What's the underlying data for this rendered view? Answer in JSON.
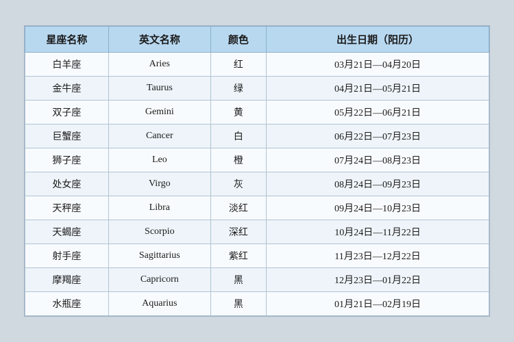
{
  "table": {
    "headers": {
      "zh_name": "星座名称",
      "en_name": "英文名称",
      "color": "颜色",
      "date": "出生日期（阳历）"
    },
    "rows": [
      {
        "zh": "白羊座",
        "en": "Aries",
        "color": "红",
        "date": "03月21日—04月20日"
      },
      {
        "zh": "金牛座",
        "en": "Taurus",
        "color": "绿",
        "date": "04月21日—05月21日"
      },
      {
        "zh": "双子座",
        "en": "Gemini",
        "color": "黄",
        "date": "05月22日—06月21日"
      },
      {
        "zh": "巨蟹座",
        "en": "Cancer",
        "color": "白",
        "date": "06月22日—07月23日"
      },
      {
        "zh": "狮子座",
        "en": "Leo",
        "color": "橙",
        "date": "07月24日—08月23日"
      },
      {
        "zh": "处女座",
        "en": "Virgo",
        "color": "灰",
        "date": "08月24日—09月23日"
      },
      {
        "zh": "天秤座",
        "en": "Libra",
        "color": "淡红",
        "date": "09月24日—10月23日"
      },
      {
        "zh": "天蝎座",
        "en": "Scorpio",
        "color": "深红",
        "date": "10月24日—11月22日"
      },
      {
        "zh": "射手座",
        "en": "Sagittarius",
        "color": "紫红",
        "date": "11月23日—12月22日"
      },
      {
        "zh": "摩羯座",
        "en": "Capricorn",
        "color": "黑",
        "date": "12月23日—01月22日"
      },
      {
        "zh": "水瓶座",
        "en": "Aquarius",
        "color": "黑",
        "date": "01月21日—02月19日"
      }
    ]
  }
}
